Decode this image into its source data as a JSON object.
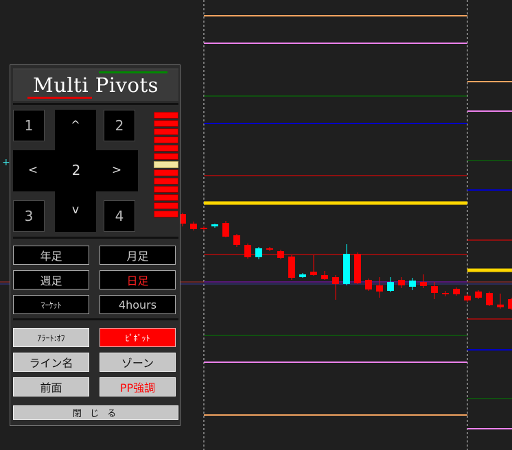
{
  "chart": {
    "background": "#1f1f1f",
    "colors": {
      "bull": "#00ffff",
      "bear": "#ff0000",
      "pivot": "#ffd700",
      "r1": "#ff0000",
      "r2": "#0000c8",
      "r3": "#008000",
      "r4": "#ee82ee",
      "r5": "#f4a460"
    }
  },
  "panel": {
    "title": "Multi Pivots",
    "pad": {
      "key1": "1",
      "key2": "2",
      "key3": "3",
      "key4": "4",
      "up": "^",
      "down": "v",
      "left": "<",
      "right": ">",
      "center": "2"
    },
    "meter": {
      "count": 13,
      "active_index": 6
    },
    "timeframes": {
      "yearly": "年足",
      "monthly": "月足",
      "weekly": "週足",
      "daily": "日足",
      "market": "ﾏｰｹｯﾄ",
      "h4": "4hours"
    },
    "options": {
      "alert": "ｱﾗｰﾄ:ｵﾌ",
      "pivot": "ﾋﾟﾎﾞｯﾄ",
      "line_name": "ライン名",
      "zone": "ゾーン",
      "front": "前面",
      "pp_emphasis": "PP強調"
    },
    "close": "閉 じ る"
  },
  "crosshair": "+"
}
